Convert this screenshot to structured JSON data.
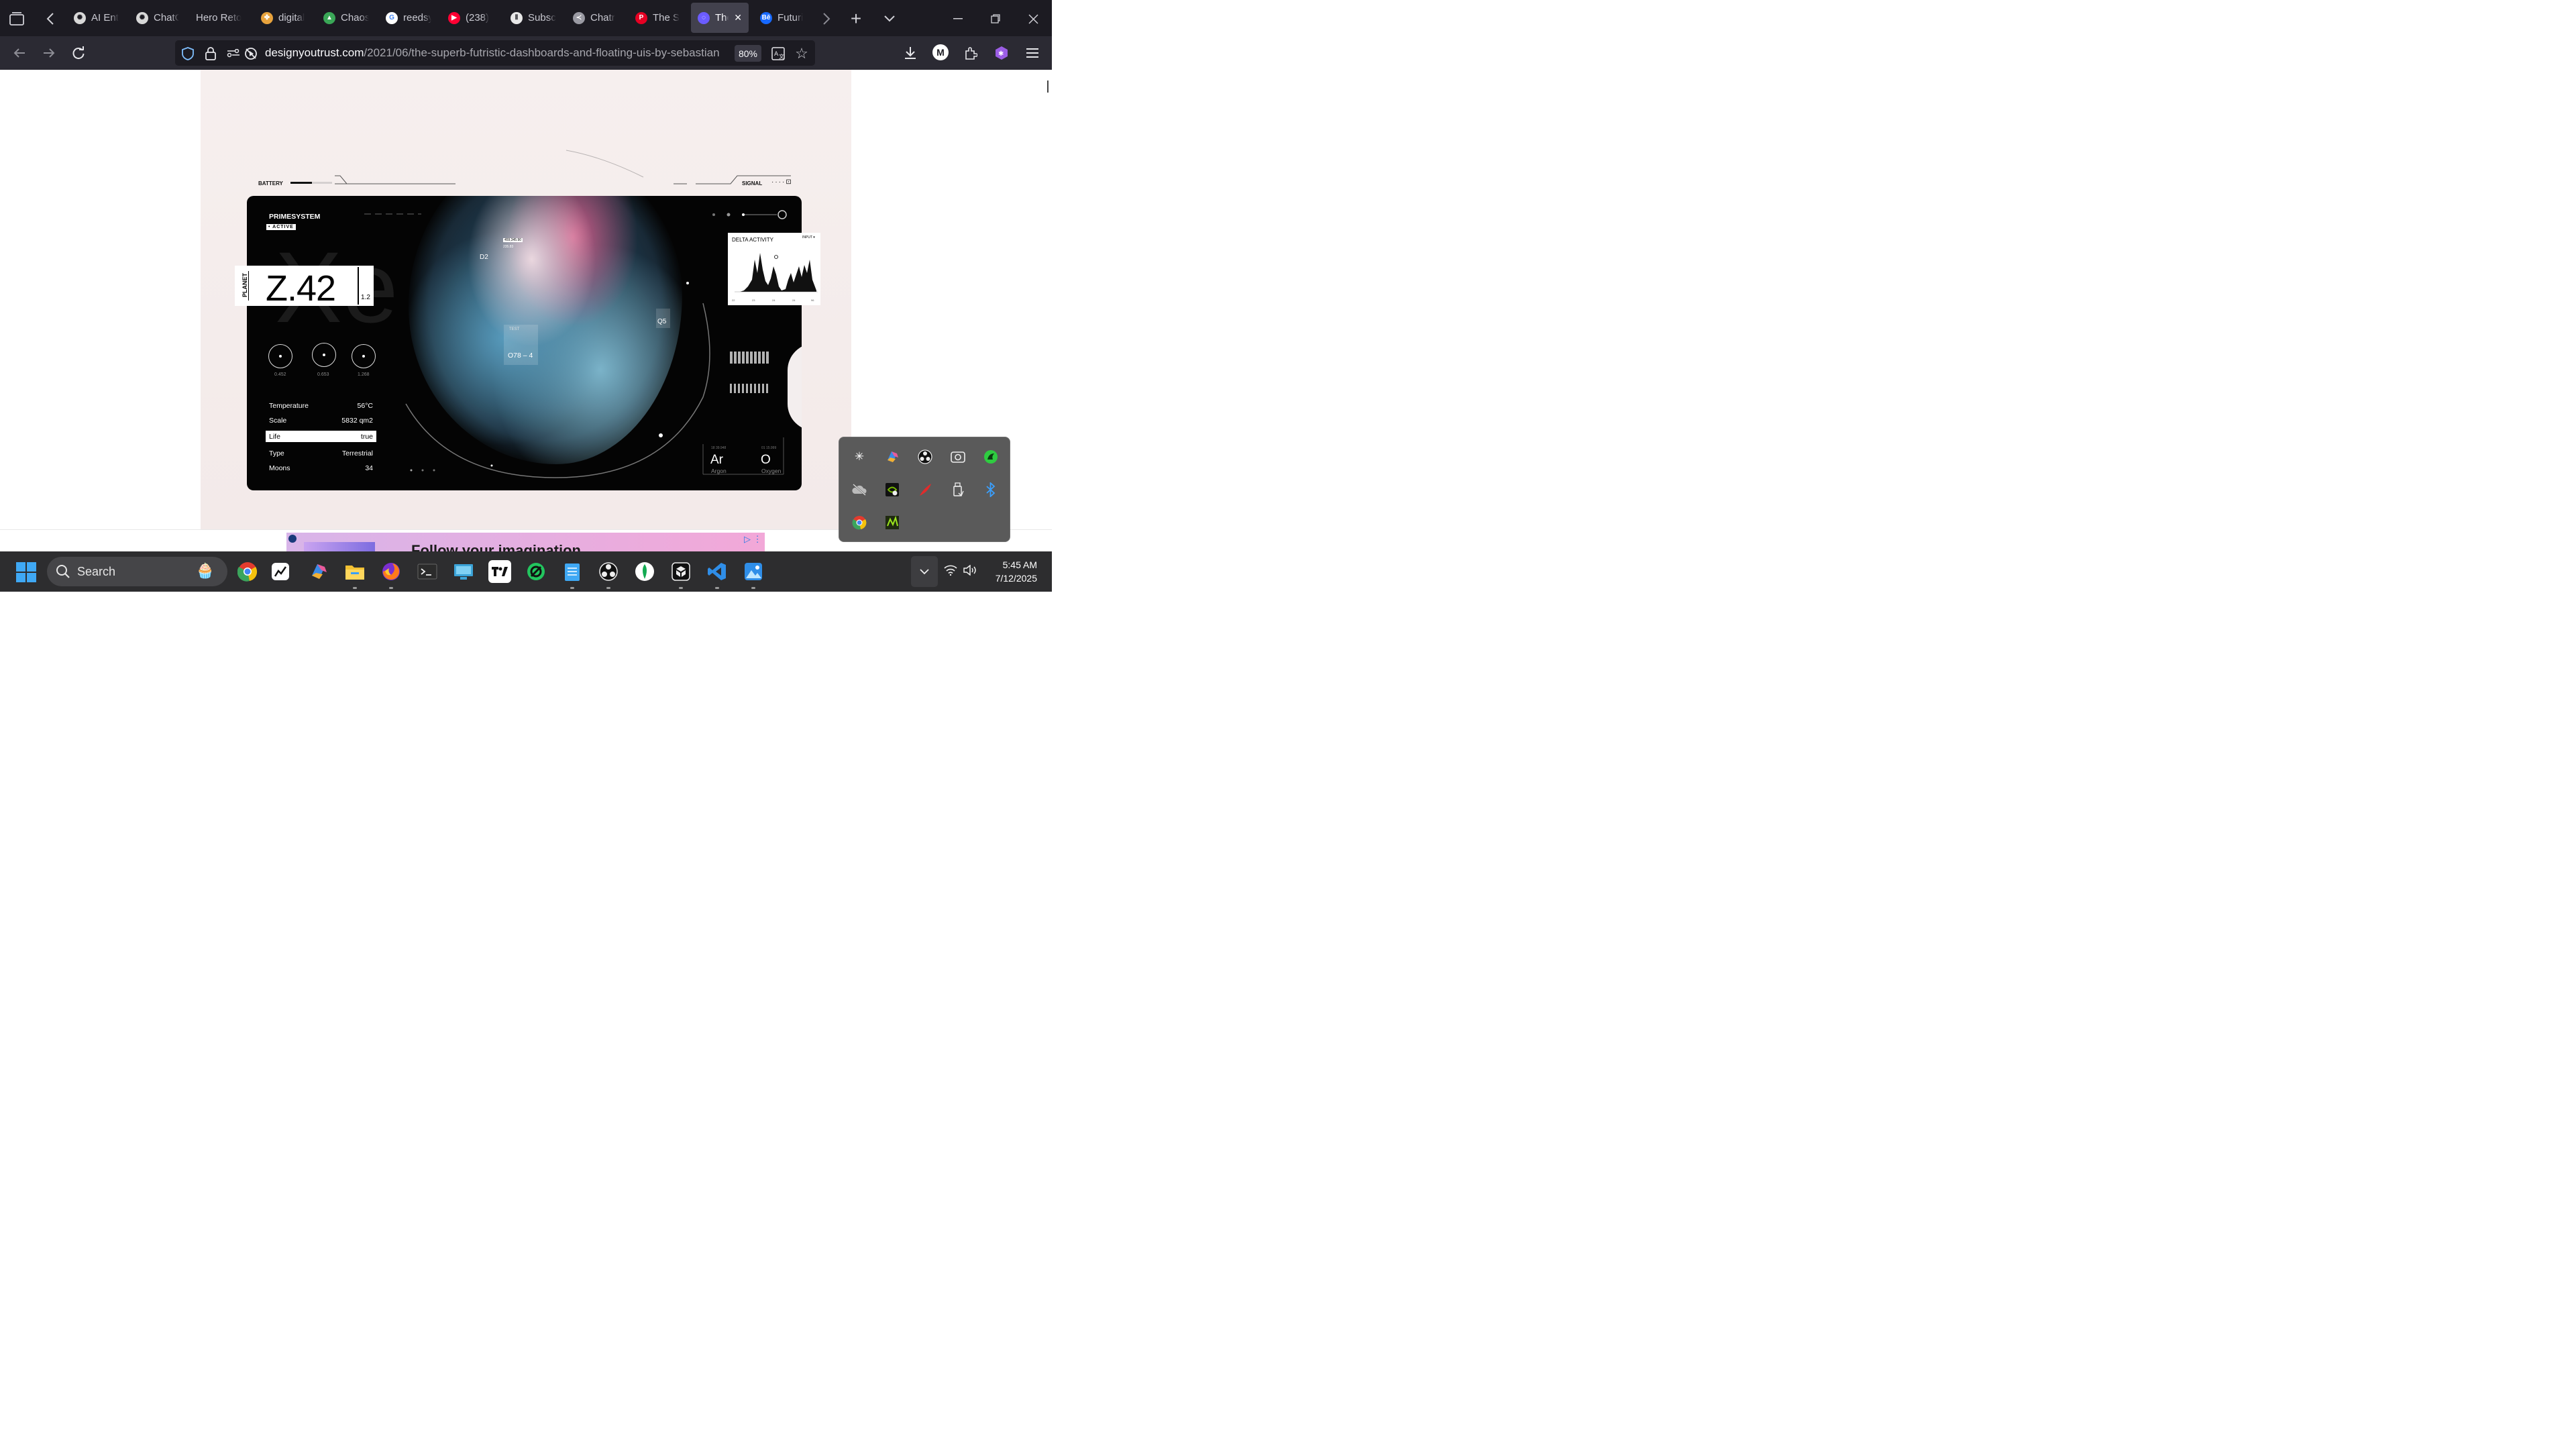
{
  "browser": {
    "tabs": [
      {
        "label": "AI Ent",
        "icon": "openai-icon",
        "color": "#1c1b22"
      },
      {
        "label": "ChatG",
        "icon": "openai-icon",
        "color": "#1c1b22"
      },
      {
        "label": "Hero Reto",
        "icon": "",
        "color": "#1c1b22"
      },
      {
        "label": "digital",
        "icon": "pinwheel-icon",
        "color": "#1c1b22"
      },
      {
        "label": "Chaos",
        "icon": "drive-icon",
        "color": "#1c1b22"
      },
      {
        "label": "reedsy",
        "icon": "google-icon",
        "color": "#1c1b22"
      },
      {
        "label": "(238)",
        "icon": "youtube-icon",
        "color": "#1c1b22"
      },
      {
        "label": "Subsc",
        "icon": "substack-icon",
        "color": "#1c1b22"
      },
      {
        "label": "Chatr",
        "icon": "chatr-icon",
        "color": "#1c1b22"
      },
      {
        "label": "The S",
        "icon": "pinterest-icon",
        "color": "#1c1b22"
      },
      {
        "label": "The",
        "icon": "spinner-icon",
        "color": "#42414d"
      },
      {
        "label": "Futuri",
        "icon": "behance-icon",
        "color": "#1c1b22"
      }
    ],
    "url_host": "designyoutrust.com",
    "url_path": "/2021/06/the-superb-futristic-dashboards-and-floating-uis-by-sebastian",
    "zoom": "80%",
    "account_initial": "M"
  },
  "dashboard": {
    "battery": "BATTERY",
    "signal": "SIGNAL",
    "system": "PRIMESYSTEM",
    "status": "• ACTIVE",
    "planet_label": "PLANET",
    "planet_value": "Z.42",
    "planet_sub": "1.2",
    "dials": [
      "0.452",
      "0.653",
      "1.268"
    ],
    "info": [
      {
        "k": "Temperature",
        "v": "56°C"
      },
      {
        "k": "Scale",
        "v": "5832 qm2"
      },
      {
        "k": "Life",
        "v": "true"
      },
      {
        "k": "Type",
        "v": "Terrestrial"
      },
      {
        "k": "Moons",
        "v": "34"
      }
    ],
    "markers": [
      "D2",
      "Q5",
      "TEST",
      "O78 – 4",
      "TEST"
    ],
    "coords": [
      "459,345.90",
      "235.83"
    ],
    "delta_title": "DELTA ACTIVITY",
    "delta_input": "INPUT ▾",
    "delta_xticks": [
      "22",
      "23",
      "24",
      "24",
      "96"
    ],
    "elements": [
      {
        "sym": "Ar",
        "name": "Argon",
        "meta": "18 39.948"
      },
      {
        "sym": "O",
        "name": "Oxygen",
        "meta": "01 15.999"
      }
    ]
  },
  "ad": {
    "text": "Follow your imagination"
  },
  "taskbar": {
    "search_placeholder": "Search",
    "time": "5:45 AM",
    "date": "7/12/2025"
  }
}
